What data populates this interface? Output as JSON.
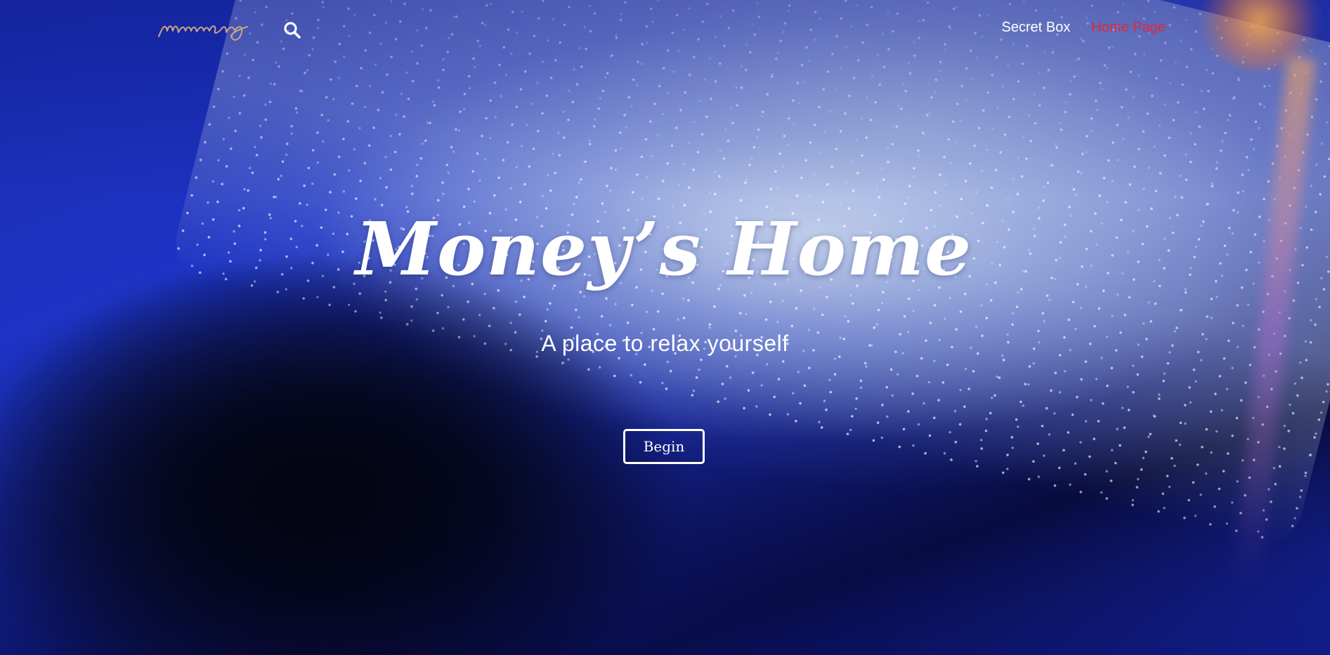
{
  "header": {
    "logo_icon": "signature-logo",
    "logo_text": "mumeng",
    "search_icon": "search-icon",
    "nav": [
      {
        "label": "Secret Box",
        "active": false
      },
      {
        "label": "Home Page",
        "active": true
      }
    ]
  },
  "hero": {
    "title": "Money’s Home",
    "subtitle": "A place to relax yourself",
    "button_label": "Begin"
  },
  "colors": {
    "active_link": "#e0283c",
    "text": "#ffffff",
    "background_blue": "#1d33c4"
  }
}
